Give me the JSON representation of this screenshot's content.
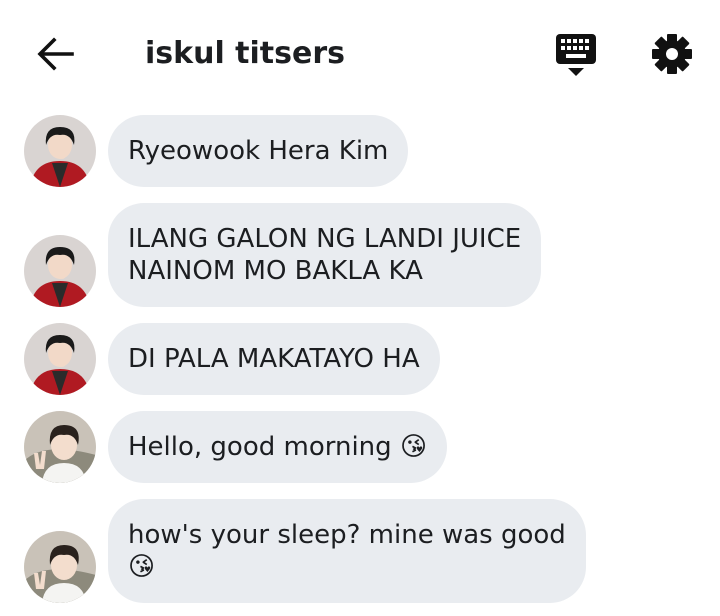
{
  "header": {
    "title": "iskul titsers",
    "back_icon": "arrow-left-icon",
    "keyboard_icon": "keyboard-icon",
    "settings_icon": "gear-icon"
  },
  "messages": [
    {
      "avatar": "avatar-red-jacket",
      "text": "Ryeowook Hera Kim"
    },
    {
      "avatar": "avatar-red-jacket",
      "line1": "ILANG GALON NG LANDI JUICE",
      "line2": "NAINOM MO BAKLA KA"
    },
    {
      "avatar": "avatar-red-jacket",
      "text": "DI PALA MAKATAYO HA"
    },
    {
      "avatar": "avatar-peace-sign",
      "text": "Hello, good morning",
      "emoji": "😘"
    },
    {
      "avatar": "avatar-peace-sign",
      "line1": "how's your sleep? mine was good",
      "emoji": "😘"
    }
  ],
  "colors": {
    "bubble": "#e9ecf0",
    "text": "#1c1e21"
  }
}
